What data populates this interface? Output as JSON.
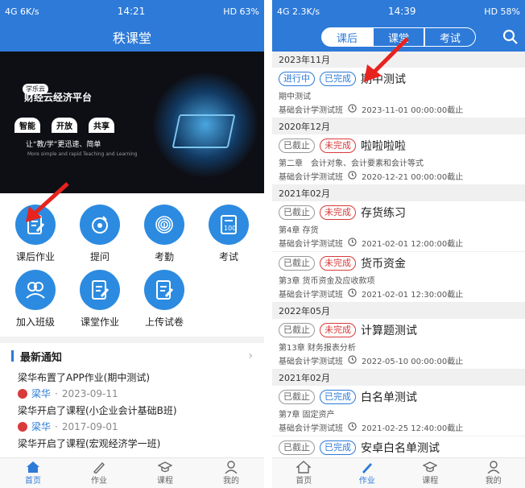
{
  "left": {
    "status": {
      "left": "4G 6K/s",
      "time": "14:21",
      "right": "HD 63%"
    },
    "title": "秩课堂",
    "banner": {
      "tag": "学乐云",
      "title": "财经云经济平台",
      "pills": [
        "智能",
        "开放",
        "共享"
      ],
      "slogan": "让“教/学”更迅速、简单",
      "slogan_en": "More simple and rapid Teaching and Learning"
    },
    "grid": [
      {
        "label": "课后作业",
        "icon": "homework-icon"
      },
      {
        "label": "提问",
        "icon": "question-icon"
      },
      {
        "label": "考勤",
        "icon": "fingerprint-icon"
      },
      {
        "label": "考试",
        "icon": "exam-icon"
      },
      {
        "label": "加入班级",
        "icon": "join-class-icon"
      },
      {
        "label": "课堂作业",
        "icon": "classwork-icon"
      },
      {
        "label": "上传试卷",
        "icon": "upload-paper-icon"
      }
    ],
    "notices_title": "最新通知",
    "notices": [
      {
        "text": "梁华布置了APP作业(期中测试)",
        "author": "梁华",
        "date": "2023-09-11"
      },
      {
        "text": "梁华开启了课程(小企业会计基础B班)",
        "author": "梁华",
        "date": "2017-09-01"
      },
      {
        "text": "梁华开启了课程(宏观经济学一班)",
        "author": "",
        "date": ""
      }
    ],
    "tabbar": [
      {
        "label": "首页",
        "icon": "home-icon",
        "active": true
      },
      {
        "label": "作业",
        "icon": "pen-icon",
        "active": false
      },
      {
        "label": "课程",
        "icon": "graduation-cap-icon",
        "active": false
      },
      {
        "label": "我的",
        "icon": "user-icon",
        "active": false
      }
    ]
  },
  "right": {
    "status": {
      "left": "4G 2.3K/s",
      "time": "14:39",
      "right": "HD 58%"
    },
    "segments": [
      "课后",
      "课堂",
      "考试"
    ],
    "active_segment": "课后",
    "groups": [
      {
        "month": "2023年11月",
        "items": [
          {
            "badges": [
              {
                "text": "进行中",
                "kind": "blue"
              },
              {
                "text": "已完成",
                "kind": "blue"
              }
            ],
            "title": "期中测试",
            "sub": "期中测试",
            "class": "基础会计学测试班",
            "due": "2023-11-01 00:00:00截止"
          }
        ]
      },
      {
        "month": "2020年12月",
        "items": [
          {
            "badges": [
              {
                "text": "已截止",
                "kind": "gray"
              },
              {
                "text": "未完成",
                "kind": "red"
              }
            ],
            "title": "啦啦啦啦",
            "sub": "第二章　会计对象、会计要素和会计等式",
            "class": "基础会计学测试班",
            "due": "2020-12-21 00:00:00截止"
          }
        ]
      },
      {
        "month": "2021年02月",
        "items": [
          {
            "badges": [
              {
                "text": "已截止",
                "kind": "gray"
              },
              {
                "text": "未完成",
                "kind": "red"
              }
            ],
            "title": "存货练习",
            "sub": "第4章 存货",
            "class": "基础会计学测试班",
            "due": "2021-02-01 12:00:00截止"
          },
          {
            "badges": [
              {
                "text": "已截止",
                "kind": "gray"
              },
              {
                "text": "未完成",
                "kind": "red"
              }
            ],
            "title": "货币资金",
            "sub": "第3章 货币资金及应收款项",
            "class": "基础会计学测试班",
            "due": "2021-02-01 12:30:00截止"
          }
        ]
      },
      {
        "month": "2022年05月",
        "items": [
          {
            "badges": [
              {
                "text": "已截止",
                "kind": "gray"
              },
              {
                "text": "未完成",
                "kind": "red"
              }
            ],
            "title": "计算题测试",
            "sub": "第13章 财务报表分析",
            "class": "基础会计学测试班",
            "due": "2022-05-10 00:00:00截止"
          }
        ]
      },
      {
        "month": "2021年02月",
        "items": [
          {
            "badges": [
              {
                "text": "已截止",
                "kind": "gray"
              },
              {
                "text": "已完成",
                "kind": "blue"
              }
            ],
            "title": "白名单测试",
            "sub": "第7章 固定资产",
            "class": "基础会计学测试班",
            "due": "2021-02-25 12:40:00截止"
          },
          {
            "badges": [
              {
                "text": "已截止",
                "kind": "gray"
              },
              {
                "text": "已完成",
                "kind": "blue"
              }
            ],
            "title": "安卓白名单测试",
            "sub": "",
            "class": "",
            "due": ""
          }
        ]
      }
    ],
    "tabbar": [
      {
        "label": "首页",
        "icon": "home-icon",
        "active": false
      },
      {
        "label": "作业",
        "icon": "pen-icon",
        "active": true
      },
      {
        "label": "课程",
        "icon": "graduation-cap-icon",
        "active": false
      },
      {
        "label": "我的",
        "icon": "user-icon",
        "active": false
      }
    ]
  },
  "colors": {
    "primary": "#2d7ad8",
    "icon_bg": "#2c8be0",
    "red": "#d93a3a",
    "annotation_arrow": "#e8231e"
  }
}
